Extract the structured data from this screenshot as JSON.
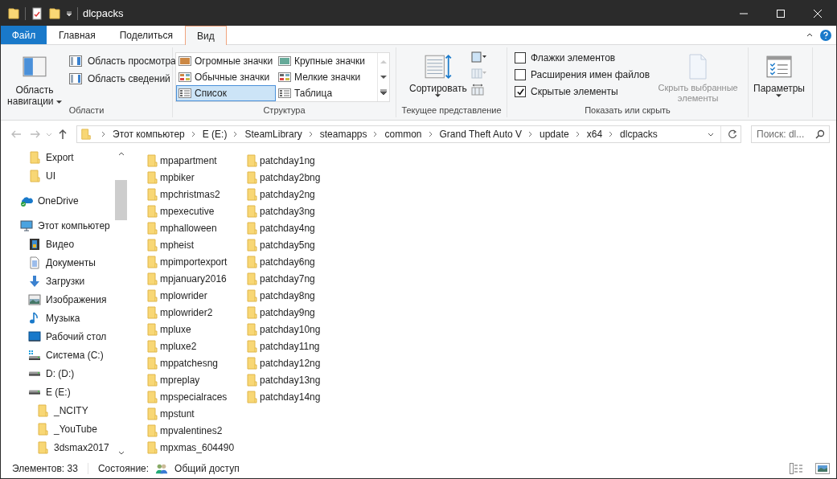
{
  "window": {
    "title": "dlcpacks"
  },
  "tabs": [
    {
      "label": "Файл",
      "kind": "file",
      "selected": false
    },
    {
      "label": "Главная",
      "kind": "tab",
      "selected": false
    },
    {
      "label": "Поделиться",
      "kind": "tab",
      "selected": false
    },
    {
      "label": "Вид",
      "kind": "tab",
      "selected": true
    }
  ],
  "ribbon": {
    "panes": {
      "title": "Области",
      "nav_button": "Область навигации",
      "buttons": [
        "Область просмотра",
        "Область сведений"
      ]
    },
    "layout": {
      "title": "Структура",
      "options": [
        {
          "label": "Огромные значки",
          "kind": "huge",
          "selected": false
        },
        {
          "label": "Крупные значки",
          "kind": "large",
          "selected": false
        },
        {
          "label": "Обычные значки",
          "kind": "medium",
          "selected": false
        },
        {
          "label": "Мелкие значки",
          "kind": "small",
          "selected": false
        },
        {
          "label": "Список",
          "kind": "list",
          "selected": true
        },
        {
          "label": "Таблица",
          "kind": "details",
          "selected": false
        }
      ]
    },
    "current_view": {
      "title": "Текущее представление",
      "sort_button": "Сортировать"
    },
    "show_hide": {
      "title": "Показать или скрыть",
      "checkboxes": [
        {
          "label": "Флажки элементов",
          "checked": false
        },
        {
          "label": "Расширения имен файлов",
          "checked": false
        },
        {
          "label": "Скрытые элементы",
          "checked": true
        }
      ],
      "hide_button": {
        "label": "Скрыть выбранные элементы",
        "disabled": true
      }
    },
    "options": {
      "button": "Параметры"
    }
  },
  "address": {
    "path": [
      "Этот компьютер",
      "E (E:)",
      "SteamLibrary",
      "steamapps",
      "common",
      "Grand Theft Auto V",
      "update",
      "x64",
      "dlcpacks"
    ]
  },
  "search": {
    "placeholder": "Поиск: dl..."
  },
  "nav": [
    {
      "children": [
        {
          "label": "Export",
          "kind": "folder"
        },
        {
          "label": "UI",
          "kind": "folder"
        }
      ]
    },
    {
      "label": "OneDrive",
      "kind": "cloud"
    },
    {
      "label": "Этот компьютер",
      "kind": "computer",
      "children": [
        {
          "label": "Видео",
          "kind": "video"
        },
        {
          "label": "Документы",
          "kind": "document"
        },
        {
          "label": "Загрузки",
          "kind": "download"
        },
        {
          "label": "Изображения",
          "kind": "picture"
        },
        {
          "label": "Музыка",
          "kind": "music"
        },
        {
          "label": "Рабочий стол",
          "kind": "desktop"
        },
        {
          "label": "Система (C:)",
          "kind": "system-drive"
        },
        {
          "label": "D: (D:)",
          "kind": "drive"
        },
        {
          "label": "E (E:)",
          "kind": "drive",
          "children": [
            {
              "label": "_NCITY",
              "kind": "folder"
            },
            {
              "label": "_YouTube",
              "kind": "folder"
            },
            {
              "label": "3dsmax2017",
              "kind": "folder"
            }
          ]
        }
      ]
    }
  ],
  "files": [
    "mpapartment",
    "mpbiker",
    "mpchristmas2",
    "mpexecutive",
    "mphalloween",
    "mpheist",
    "mpimportexport",
    "mpjanuary2016",
    "mplowrider",
    "mplowrider2",
    "mpluxe",
    "mpluxe2",
    "mppatchesng",
    "mpreplay",
    "mpspecialraces",
    "mpstunt",
    "mpvalentines2",
    "mpxmas_604490",
    "patchday1ng",
    "patchday2bng",
    "patchday2ng",
    "patchday3ng",
    "patchday4ng",
    "patchday5ng",
    "patchday6ng",
    "patchday7ng",
    "patchday8ng",
    "patchday9ng",
    "patchday10ng",
    "patchday11ng",
    "patchday12ng",
    "patchday13ng",
    "patchday14ng"
  ],
  "status_bar": {
    "count": "Элементов: 33",
    "state_label": "Состояние:",
    "state_value": "Общий доступ"
  }
}
